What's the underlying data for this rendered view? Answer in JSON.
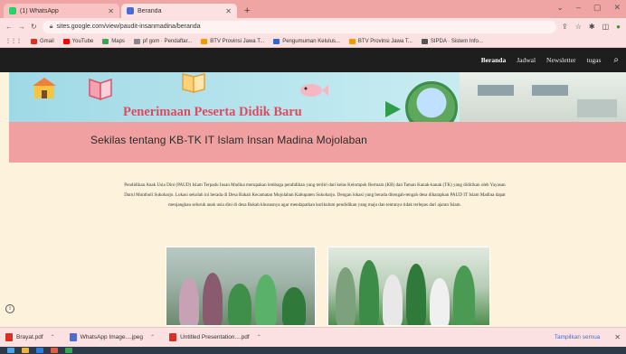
{
  "browser": {
    "tabs": [
      {
        "label": "(1) WhatsApp",
        "icon": "whatsapp-icon",
        "color": "#25d366",
        "active": false
      },
      {
        "label": "Beranda",
        "icon": "google-sites-icon",
        "color": "#4a6cd4",
        "active": true
      }
    ],
    "new_tab": "+",
    "url": "sites.google.com/view/paudit-insanmadina/beranda",
    "bookmarks": [
      {
        "label": "Gmail",
        "color": "#d93025"
      },
      {
        "label": "YouTube",
        "color": "#ff0000"
      },
      {
        "label": "Maps",
        "color": "#34a853"
      },
      {
        "label": "pf gom · Pendaftar...",
        "color": "#888888"
      },
      {
        "label": "BTV Provinsi Jawa T...",
        "color": "#f29900"
      },
      {
        "label": "Pengumuman Kelulus...",
        "color": "#3367d6"
      },
      {
        "label": "BTV Provinsi Jawa T...",
        "color": "#f29900"
      },
      {
        "label": "SIPDA · Sistem Info...",
        "color": "#555555"
      }
    ]
  },
  "site": {
    "nav": [
      "Beranda",
      "Jadwal",
      "Newsletter",
      "tugas"
    ],
    "banner_title": "Penerimaan Peserta Didik Baru",
    "section_title": "Sekilas tentang KB-TK IT Islam Insan Madina Mojolaban",
    "paragraph": "Pendidikan Anak Usia Dini (PAUD) Islam Terpadu Insan Madina merupakan lembaga pendidikan yang terdiri dari kelas Kelompok Bermain (KB) dan Taman Kanak-kanak (TK) yang didirikan oleh Yayasan Darul Muntholi Sukoharjo. Lokasi sekolah ini berada di Desa Bakah Kecamatan Mojolaban Kabupaten Sukoharjo. Dengan lokasi yang berada ditengah-tengah desa diharapkan PAUD IT Islam Madina dapat menjangkau seluruh anak usia dini di desa Bakah khususnya agar mendapatkan kurikulum pendidikan yang maju dan tentunya tidak terlepas dari ajaran Islam."
  },
  "downloads": {
    "items": [
      {
        "label": "Brayat.pdf",
        "color": "#d93025"
      },
      {
        "label": "WhatsApp Image....jpeg",
        "color": "#4a6cd4"
      },
      {
        "label": "Untitled Presentation....pdf",
        "color": "#d93025"
      }
    ],
    "show_all": "Tampilkan semua"
  },
  "colors": {
    "nav_bg": "#1e1e1e",
    "title_band": "#f0a0a0",
    "page_bg": "#fdf3dc",
    "banner_title": "#e04a5f"
  }
}
